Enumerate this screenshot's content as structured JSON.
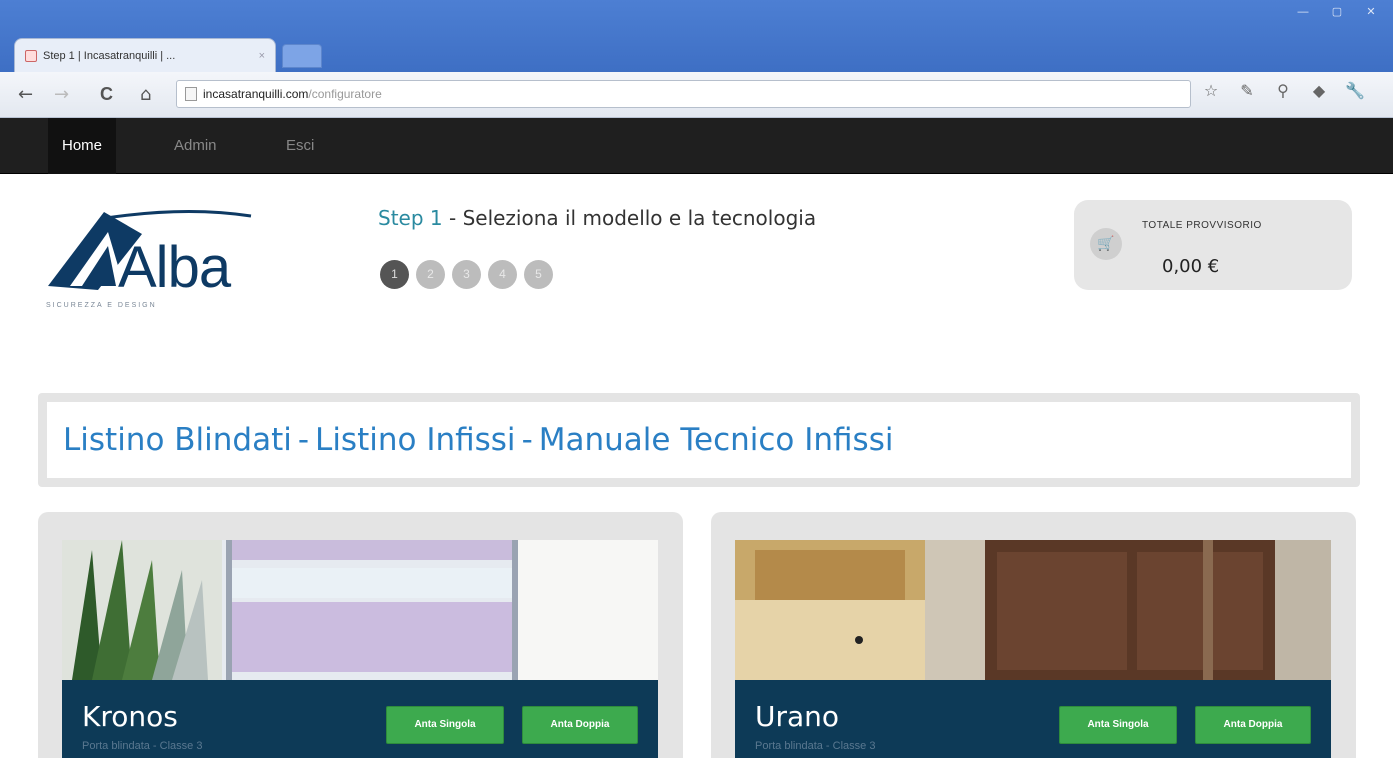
{
  "browser": {
    "tab_title": "Step 1 | Incasatranquilli | ...",
    "tab_close": "×",
    "window_buttons": [
      "—",
      "▢",
      "✕"
    ],
    "nav": {
      "back": "←",
      "forward": "→",
      "reload": "C",
      "home": "⌂"
    },
    "url_host": "incasatranquilli.com",
    "url_path": "/configuratore",
    "extensions": [
      "☆",
      "✎",
      "⚲",
      "◆",
      "🔧"
    ]
  },
  "sitenav": {
    "items": [
      {
        "label": "Home",
        "active": true
      },
      {
        "label": "Admin",
        "active": false
      },
      {
        "label": "Esci",
        "active": false
      }
    ]
  },
  "logo": {
    "word": "Alba",
    "tagline": "SICUREZZA E DESIGN"
  },
  "step": {
    "number": "Step 1",
    "separator": " - ",
    "title": "Seleziona il modello e la tecnologia",
    "dots": [
      "1",
      "2",
      "3",
      "4",
      "5"
    ],
    "active_index": 0
  },
  "cart": {
    "icon": "🛒",
    "label": "TOTALE PROVVISORIO",
    "value": "0,00 €"
  },
  "links": {
    "items": [
      "Listino Blindati",
      "Listino Infissi",
      "Manuale Tecnico Infissi"
    ],
    "separator": "-"
  },
  "products": [
    {
      "name": "Kronos",
      "subtitle": "Porta blindata - Classe 3",
      "btn_single": "Anta Singola",
      "btn_double": "Anta Doppia"
    },
    {
      "name": "Urano",
      "subtitle": "Porta blindata - Classe 3",
      "btn_single": "Anta Singola",
      "btn_double": "Anta Doppia"
    }
  ]
}
